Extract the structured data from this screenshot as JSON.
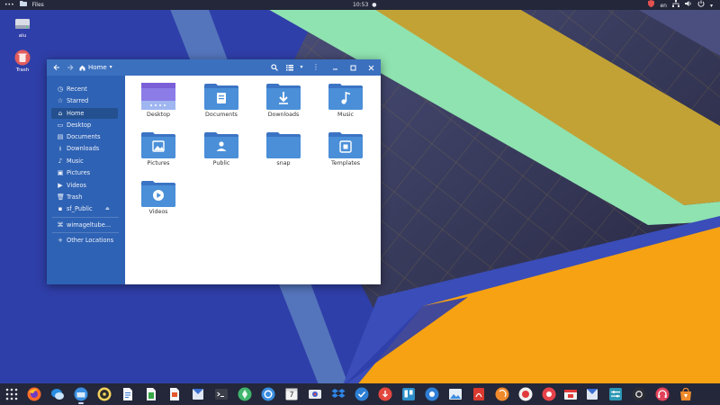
{
  "topbar": {
    "activities_icon": "apps-dots-icon",
    "app_name": "Files",
    "clock": "10:53",
    "language": "en"
  },
  "desktop": {
    "icons": [
      {
        "label": "alu",
        "icon": "drive-icon"
      },
      {
        "label": "Trash",
        "icon": "trash-icon"
      }
    ]
  },
  "window": {
    "location": "Home",
    "sidebar": {
      "items": [
        {
          "label": "Recent",
          "icon": "clock-icon"
        },
        {
          "label": "Starred",
          "icon": "star-icon"
        },
        {
          "label": "Home",
          "icon": "home-icon",
          "active": true
        },
        {
          "label": "Desktop",
          "icon": "desktop-icon"
        },
        {
          "label": "Documents",
          "icon": "document-icon"
        },
        {
          "label": "Downloads",
          "icon": "download-icon"
        },
        {
          "label": "Music",
          "icon": "music-icon"
        },
        {
          "label": "Pictures",
          "icon": "picture-icon"
        },
        {
          "label": "Videos",
          "icon": "video-icon"
        },
        {
          "label": "Trash",
          "icon": "trash-icon"
        },
        {
          "label": "sf_Public",
          "icon": "shared-drive-icon"
        }
      ],
      "network": {
        "label": "wimageltube...",
        "icon": "network-icon"
      },
      "other": {
        "label": "Other Locations",
        "icon": "plus-icon"
      }
    },
    "folders": [
      {
        "label": "Desktop",
        "emblem": "desktop"
      },
      {
        "label": "Documents",
        "emblem": "document"
      },
      {
        "label": "Downloads",
        "emblem": "download"
      },
      {
        "label": "Music",
        "emblem": "music"
      },
      {
        "label": "Pictures",
        "emblem": "picture"
      },
      {
        "label": "Public",
        "emblem": "person"
      },
      {
        "label": "snap",
        "emblem": "none"
      },
      {
        "label": "Templates",
        "emblem": "template"
      },
      {
        "label": "Videos",
        "emblem": "video"
      }
    ]
  },
  "dock": {
    "items": [
      "show-apps-icon",
      "firefox-icon",
      "chat-icon",
      "files-icon",
      "rhythmbox-icon",
      "writer-icon",
      "calc-icon",
      "impress-icon",
      "mail-icon",
      "terminal-icon",
      "tor-icon",
      "chrome-icon",
      "calendar-icon",
      "screenshot-icon",
      "dropbox-icon",
      "check-icon",
      "download-app-icon",
      "trello-icon",
      "record-icon",
      "image-viewer-icon",
      "pdf-icon",
      "music-player-icon",
      "screen-recorder-icon",
      "photo-app-icon",
      "clapper-icon",
      "email-icon",
      "settings-icon",
      "terminal-app-icon",
      "headphones-icon",
      "store-icon"
    ],
    "calendar_day": "7"
  },
  "colors": {
    "wallpaper": "#2f3fa9",
    "sidebar": "#2e62b4",
    "headerbar": "#3b70bf",
    "folder": "#4a8fd8",
    "orange": "#f7a212",
    "teal": "#8fe3b0",
    "gold": "#c2a235"
  }
}
